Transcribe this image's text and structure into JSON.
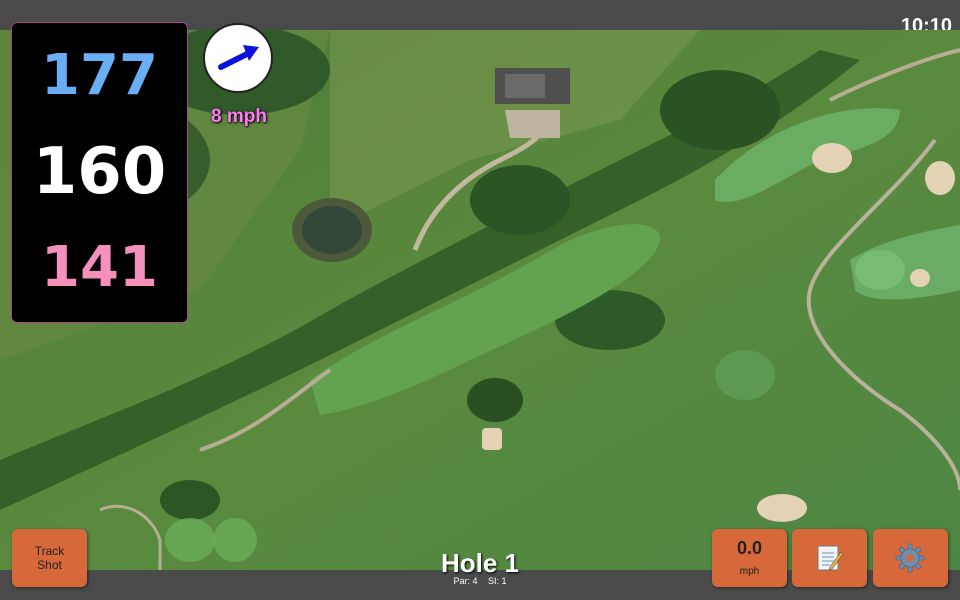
{
  "status": {
    "clock": "10:10"
  },
  "yardages": {
    "back": "177",
    "middle": "160",
    "front": "141"
  },
  "wind": {
    "speed": "8 mph",
    "direction_icon": "arrow-icon"
  },
  "hole": {
    "title": "Hole 1",
    "par": "Par: 4",
    "si": "SI: 1"
  },
  "buttons": {
    "track_shot": "Track Shot",
    "speed_value": "0.0",
    "speed_unit": "mph",
    "notes_icon": "notepad-icon",
    "settings_icon": "gear-icon"
  },
  "colors": {
    "back_yardage": "#6aaef5",
    "middle_yardage": "#ffffff",
    "front_yardage": "#f58fbc",
    "wind_text": "#ff7af5",
    "button": "#d6683a"
  }
}
